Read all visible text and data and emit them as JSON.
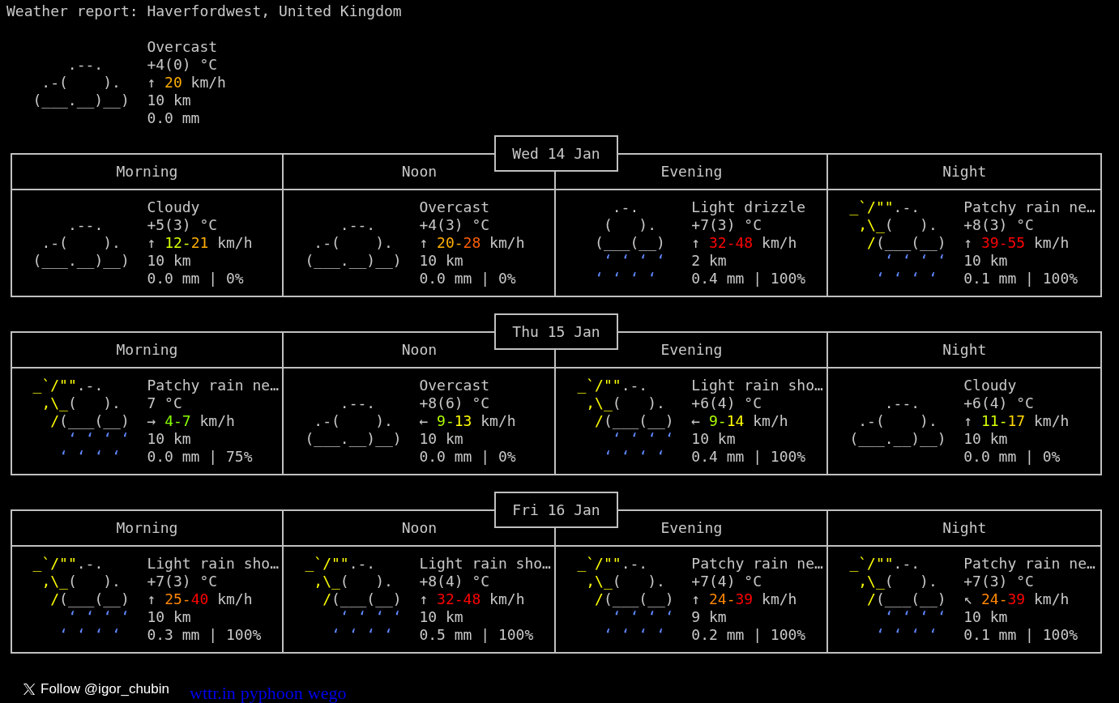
{
  "title": "Weather report: Haverfordwest, United Kingdom",
  "current": {
    "art": [
      [
        {
          "text": "       .--.",
          "kind": "cloud"
        }
      ],
      [
        {
          "text": "    .-(    ).",
          "kind": "cloud"
        }
      ],
      [
        {
          "text": "   (___.__)__)",
          "kind": "cloud"
        }
      ]
    ],
    "condition": "Overcast",
    "temperature": "+4(0) °C",
    "wind": [
      {
        "text": "↑ "
      },
      {
        "text": "20",
        "color": "#ffaf00"
      },
      {
        "text": " km/h"
      }
    ],
    "visibility": "10 km",
    "precipitation": "0.0 mm"
  },
  "days": [
    {
      "date": "Wed 14 Jan",
      "periods": [
        {
          "label": "Morning",
          "art": [
            [
              {
                "text": "      .--.",
                "kind": "cloud"
              }
            ],
            [
              {
                "text": "   .-(    ).",
                "kind": "cloud"
              }
            ],
            [
              {
                "text": "  (___.__)__)",
                "kind": "cloud"
              }
            ]
          ],
          "condition": "Cloudy",
          "temperature": "+5(3) °C",
          "wind": [
            {
              "text": "↑ "
            },
            {
              "text": "12",
              "color": "#d7ff00"
            },
            {
              "text": "-",
              "color": "#d7ff00"
            },
            {
              "text": "21",
              "color": "#ffaf00"
            },
            {
              "text": " km/h"
            }
          ],
          "visibility": "10 km",
          "precipitation": "0.0 mm | 0%"
        },
        {
          "label": "Noon",
          "art": [
            [
              {
                "text": "      .--.",
                "kind": "cloud"
              }
            ],
            [
              {
                "text": "   .-(    ).",
                "kind": "cloud"
              }
            ],
            [
              {
                "text": "  (___.__)__)",
                "kind": "cloud"
              }
            ]
          ],
          "condition": "Overcast",
          "temperature": "+4(3) °C",
          "wind": [
            {
              "text": "↑ "
            },
            {
              "text": "20",
              "color": "#ffaf00"
            },
            {
              "text": "-",
              "color": "#ffaf00"
            },
            {
              "text": "28",
              "color": "#ff5f00"
            },
            {
              "text": " km/h"
            }
          ],
          "visibility": "10 km",
          "precipitation": "0.0 mm | 0%"
        },
        {
          "label": "Evening",
          "art": [
            [
              {
                "text": "      .-.",
                "kind": "cloud"
              }
            ],
            [
              {
                "text": "     (   ).",
                "kind": "cloud"
              }
            ],
            [
              {
                "text": "    (___(__)",
                "kind": "cloud"
              }
            ],
            [
              {
                "text": "     ‘ ‘ ‘ ‘",
                "kind": "rain"
              }
            ],
            [
              {
                "text": "    ‘ ‘ ‘ ‘",
                "kind": "rain"
              }
            ]
          ],
          "condition": "Light drizzle",
          "temperature": "+7(3) °C",
          "wind": [
            {
              "text": "↑ "
            },
            {
              "text": "32",
              "color": "#ff0000"
            },
            {
              "text": "-",
              "color": "#ff0000"
            },
            {
              "text": "48",
              "color": "#ff0000"
            },
            {
              "text": " km/h"
            }
          ],
          "visibility": "2 km",
          "precipitation": "0.4 mm | 100%"
        },
        {
          "label": "Night",
          "art": [
            [
              {
                "text": "  _`/\"\"",
                "kind": "sun"
              },
              {
                "text": ".-.",
                "kind": "cloud"
              }
            ],
            [
              {
                "text": "   ,\\_",
                "kind": "sun"
              },
              {
                "text": "(   ).",
                "kind": "cloud"
              }
            ],
            [
              {
                "text": "    /",
                "kind": "sun"
              },
              {
                "text": "(___(__)",
                "kind": "cloud"
              }
            ],
            [
              {
                "text": "      ‘ ‘ ‘ ‘",
                "kind": "rain"
              }
            ],
            [
              {
                "text": "     ‘ ‘ ‘ ‘",
                "kind": "rain"
              }
            ]
          ],
          "condition": "Patchy rain ne…",
          "temperature": "+8(3) °C",
          "wind": [
            {
              "text": "↑ "
            },
            {
              "text": "39",
              "color": "#ff0000"
            },
            {
              "text": "-",
              "color": "#ff0000"
            },
            {
              "text": "55",
              "color": "#ff0000"
            },
            {
              "text": " km/h"
            }
          ],
          "visibility": "10 km",
          "precipitation": "0.1 mm | 100%"
        }
      ]
    },
    {
      "date": "Thu 15 Jan",
      "periods": [
        {
          "label": "Morning",
          "art": [
            [
              {
                "text": "  _`/\"\"",
                "kind": "sun"
              },
              {
                "text": ".-.",
                "kind": "cloud"
              }
            ],
            [
              {
                "text": "   ,\\_",
                "kind": "sun"
              },
              {
                "text": "(   ).",
                "kind": "cloud"
              }
            ],
            [
              {
                "text": "    /",
                "kind": "sun"
              },
              {
                "text": "(___(__)",
                "kind": "cloud"
              }
            ],
            [
              {
                "text": "      ‘ ‘ ‘ ‘",
                "kind": "rain"
              }
            ],
            [
              {
                "text": "     ‘ ‘ ‘ ‘",
                "kind": "rain"
              }
            ]
          ],
          "condition": "Patchy rain ne…",
          "temperature": "7 °C",
          "wind": [
            {
              "text": "→ "
            },
            {
              "text": "4",
              "color": "#87ff00"
            },
            {
              "text": "-",
              "color": "#87ff00"
            },
            {
              "text": "7",
              "color": "#87ff00"
            },
            {
              "text": " km/h"
            }
          ],
          "visibility": "10 km",
          "precipitation": "0.0 mm | 75%"
        },
        {
          "label": "Noon",
          "art": [
            [
              {
                "text": "      .--.",
                "kind": "cloud"
              }
            ],
            [
              {
                "text": "   .-(    ).",
                "kind": "cloud"
              }
            ],
            [
              {
                "text": "  (___.__)__)",
                "kind": "cloud"
              }
            ]
          ],
          "condition": "Overcast",
          "temperature": "+8(6) °C",
          "wind": [
            {
              "text": "← "
            },
            {
              "text": "9",
              "color": "#afff00"
            },
            {
              "text": "-",
              "color": "#afff00"
            },
            {
              "text": "13",
              "color": "#ffff00"
            },
            {
              "text": " km/h"
            }
          ],
          "visibility": "10 km",
          "precipitation": "0.0 mm | 0%"
        },
        {
          "label": "Evening",
          "art": [
            [
              {
                "text": "  _`/\"\"",
                "kind": "sun"
              },
              {
                "text": ".-.",
                "kind": "cloud"
              }
            ],
            [
              {
                "text": "   ,\\_",
                "kind": "sun"
              },
              {
                "text": "(   ).",
                "kind": "cloud"
              }
            ],
            [
              {
                "text": "    /",
                "kind": "sun"
              },
              {
                "text": "(___(__)",
                "kind": "cloud"
              }
            ],
            [
              {
                "text": "      ‘ ‘ ‘ ‘",
                "kind": "rain"
              }
            ],
            [
              {
                "text": "     ‘ ‘ ‘ ‘",
                "kind": "rain"
              }
            ]
          ],
          "condition": "Light rain sho…",
          "temperature": "+6(4) °C",
          "wind": [
            {
              "text": "← "
            },
            {
              "text": "9",
              "color": "#afff00"
            },
            {
              "text": "-",
              "color": "#afff00"
            },
            {
              "text": "14",
              "color": "#ffff00"
            },
            {
              "text": " km/h"
            }
          ],
          "visibility": "10 km",
          "precipitation": "0.4 mm | 100%"
        },
        {
          "label": "Night",
          "art": [
            [
              {
                "text": "      .--.",
                "kind": "cloud"
              }
            ],
            [
              {
                "text": "   .-(    ).",
                "kind": "cloud"
              }
            ],
            [
              {
                "text": "  (___.__)__)",
                "kind": "cloud"
              }
            ]
          ],
          "condition": "Cloudy",
          "temperature": "+6(4) °C",
          "wind": [
            {
              "text": "↑ "
            },
            {
              "text": "11",
              "color": "#d7ff00"
            },
            {
              "text": "-",
              "color": "#d7ff00"
            },
            {
              "text": "17",
              "color": "#ffd700"
            },
            {
              "text": " km/h"
            }
          ],
          "visibility": "10 km",
          "precipitation": "0.0 mm | 0%"
        }
      ]
    },
    {
      "date": "Fri 16 Jan",
      "periods": [
        {
          "label": "Morning",
          "art": [
            [
              {
                "text": "  _`/\"\"",
                "kind": "sun"
              },
              {
                "text": ".-.",
                "kind": "cloud"
              }
            ],
            [
              {
                "text": "   ,\\_",
                "kind": "sun"
              },
              {
                "text": "(   ).",
                "kind": "cloud"
              }
            ],
            [
              {
                "text": "    /",
                "kind": "sun"
              },
              {
                "text": "(___(__)",
                "kind": "cloud"
              }
            ],
            [
              {
                "text": "      ‘ ‘ ‘ ‘",
                "kind": "rain"
              }
            ],
            [
              {
                "text": "     ‘ ‘ ‘ ‘",
                "kind": "rain"
              }
            ]
          ],
          "condition": "Light rain sho…",
          "temperature": "+7(3) °C",
          "wind": [
            {
              "text": "↑ "
            },
            {
              "text": "25",
              "color": "#ff8700"
            },
            {
              "text": "-",
              "color": "#ff8700"
            },
            {
              "text": "40",
              "color": "#ff0000"
            },
            {
              "text": " km/h"
            }
          ],
          "visibility": "10 km",
          "precipitation": "0.3 mm | 100%"
        },
        {
          "label": "Noon",
          "art": [
            [
              {
                "text": "  _`/\"\"",
                "kind": "sun"
              },
              {
                "text": ".-.",
                "kind": "cloud"
              }
            ],
            [
              {
                "text": "   ,\\_",
                "kind": "sun"
              },
              {
                "text": "(   ).",
                "kind": "cloud"
              }
            ],
            [
              {
                "text": "    /",
                "kind": "sun"
              },
              {
                "text": "(___(__)",
                "kind": "cloud"
              }
            ],
            [
              {
                "text": "      ‘ ‘ ‘ ‘",
                "kind": "rain"
              }
            ],
            [
              {
                "text": "     ‘ ‘ ‘ ‘",
                "kind": "rain"
              }
            ]
          ],
          "condition": "Light rain sho…",
          "temperature": "+8(4) °C",
          "wind": [
            {
              "text": "↑ "
            },
            {
              "text": "32",
              "color": "#ff0000"
            },
            {
              "text": "-",
              "color": "#ff0000"
            },
            {
              "text": "48",
              "color": "#ff0000"
            },
            {
              "text": " km/h"
            }
          ],
          "visibility": "10 km",
          "precipitation": "0.5 mm | 100%"
        },
        {
          "label": "Evening",
          "art": [
            [
              {
                "text": "  _`/\"\"",
                "kind": "sun"
              },
              {
                "text": ".-.",
                "kind": "cloud"
              }
            ],
            [
              {
                "text": "   ,\\_",
                "kind": "sun"
              },
              {
                "text": "(   ).",
                "kind": "cloud"
              }
            ],
            [
              {
                "text": "    /",
                "kind": "sun"
              },
              {
                "text": "(___(__)",
                "kind": "cloud"
              }
            ],
            [
              {
                "text": "      ‘ ‘ ‘ ‘",
                "kind": "rain"
              }
            ],
            [
              {
                "text": "     ‘ ‘ ‘ ‘",
                "kind": "rain"
              }
            ]
          ],
          "condition": "Patchy rain ne…",
          "temperature": "+7(4) °C",
          "wind": [
            {
              "text": "↑ "
            },
            {
              "text": "24",
              "color": "#ff8700"
            },
            {
              "text": "-",
              "color": "#ff8700"
            },
            {
              "text": "39",
              "color": "#ff0000"
            },
            {
              "text": " km/h"
            }
          ],
          "visibility": "9 km",
          "precipitation": "0.2 mm | 100%"
        },
        {
          "label": "Night",
          "art": [
            [
              {
                "text": "  _`/\"\"",
                "kind": "sun"
              },
              {
                "text": ".-.",
                "kind": "cloud"
              }
            ],
            [
              {
                "text": "   ,\\_",
                "kind": "sun"
              },
              {
                "text": "(   ).",
                "kind": "cloud"
              }
            ],
            [
              {
                "text": "    /",
                "kind": "sun"
              },
              {
                "text": "(___(__)",
                "kind": "cloud"
              }
            ],
            [
              {
                "text": "      ‘ ‘ ‘ ‘",
                "kind": "rain"
              }
            ],
            [
              {
                "text": "     ‘ ‘ ‘ ‘",
                "kind": "rain"
              }
            ]
          ],
          "condition": "Patchy rain ne…",
          "temperature": "+7(3) °C",
          "wind": [
            {
              "text": "↖ "
            },
            {
              "text": "24",
              "color": "#ff8700"
            },
            {
              "text": "-",
              "color": "#ff8700"
            },
            {
              "text": "39",
              "color": "#ff0000"
            },
            {
              "text": " km/h"
            }
          ],
          "visibility": "10 km",
          "precipitation": "0.1 mm | 100%"
        }
      ]
    }
  ],
  "footer": {
    "follow": "Follow @igor_chubin",
    "links": [
      "wttr.in",
      "pyphoon",
      "wego"
    ]
  }
}
